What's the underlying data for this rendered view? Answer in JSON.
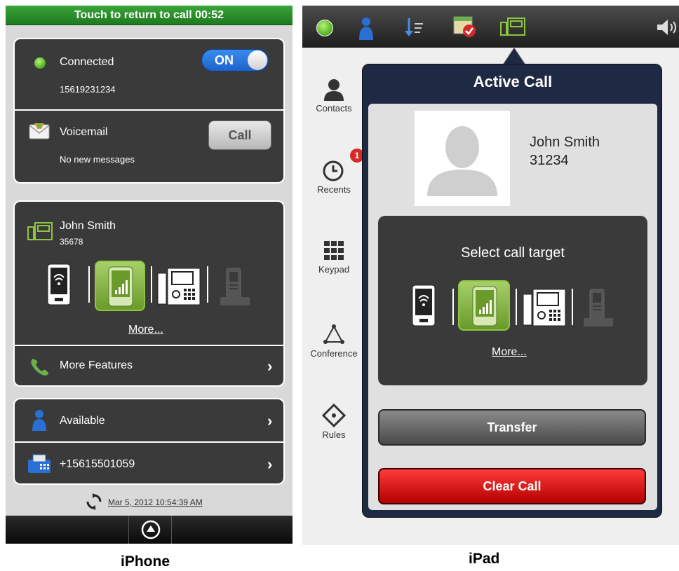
{
  "iphone": {
    "banner": "Touch to return to call  00:52",
    "connected_label": "Connected",
    "toggle_label": "ON",
    "phone_number": "15619231234",
    "voicemail_label": "Voicemail",
    "voicemail_status": "No new messages",
    "call_button": "Call",
    "contact_name": "John Smith",
    "contact_ext": "35678",
    "more_link": "More...",
    "more_features": "More Features",
    "available": "Available",
    "fwd_number": "+15615501059",
    "sync_time": "Mar 5, 2012 10:54:39 AM",
    "caption": "iPhone"
  },
  "ipad": {
    "sidebar": [
      "Contacts",
      "Recents",
      "Keypad",
      "Conference",
      "Rules"
    ],
    "recents_badge": "1",
    "popover_title": "Active Call",
    "caller_name": "John Smith",
    "caller_ext": "31234",
    "select_target": "Select call target",
    "more_link": "More...",
    "transfer_button": "Transfer",
    "clear_button": "Clear Call",
    "caption": "iPad"
  },
  "colors": {
    "accent_green": "#8ec63f",
    "toggle_blue": "#2a78e4",
    "clear_red": "#d80000",
    "banner_green": "#2e8f2e"
  },
  "icons": [
    "status-dot-icon",
    "person-icon",
    "sort-icon",
    "calendar-check-icon",
    "desk-phone-icon",
    "speaker-icon",
    "mobile-wifi-icon",
    "mobile-signal-icon",
    "ip-phone-icon",
    "cordless-phone-icon",
    "voicemail-envelope-icon",
    "phone-handset-icon",
    "fax-icon",
    "sync-icon",
    "eject-up-icon",
    "clock-icon",
    "keypad-grid-icon",
    "conference-triangle-icon",
    "rules-diamond-icon"
  ]
}
